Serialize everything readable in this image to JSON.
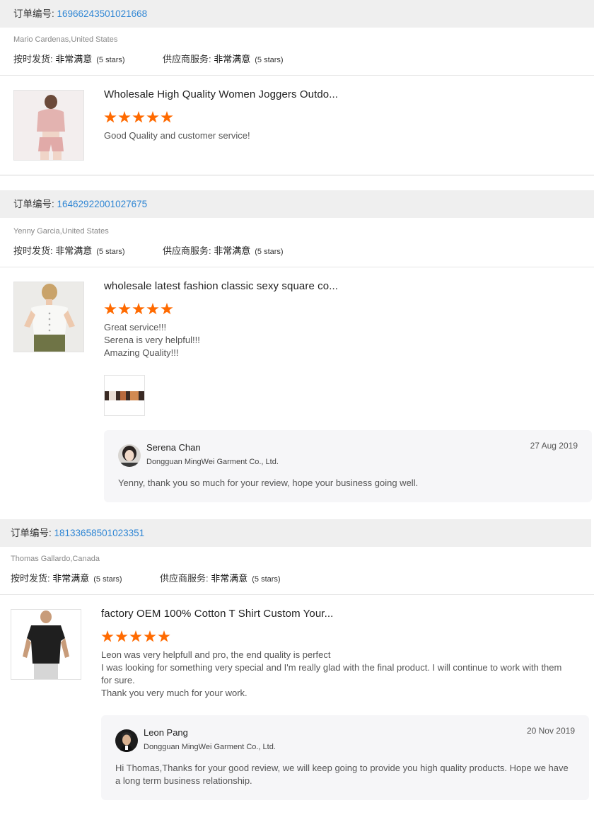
{
  "labels": {
    "order_prefix": "订单编号: ",
    "ontime_delivery": "按时发货: ",
    "supplier_service": "供应商服务: "
  },
  "reviews": [
    {
      "order_no": "16966243501021668",
      "buyer": "Mario Cardenas,United States",
      "ontime_value": "非常满意",
      "ontime_stars": "(5 stars)",
      "service_value": "非常满意",
      "service_stars": "(5 stars)",
      "product_title": "Wholesale High Quality Women Joggers Outdo...",
      "rating": 5,
      "comment": "Good Quality and customer service!"
    },
    {
      "order_no": "16462922001027675",
      "buyer": "Yenny Garcia,United States",
      "ontime_value": "非常满意",
      "ontime_stars": "(5 stars)",
      "service_value": "非常满意",
      "service_stars": "(5 stars)",
      "product_title": "wholesale latest fashion classic sexy square co...",
      "rating": 5,
      "comment": [
        "Great service!!!",
        "Serena is very helpful!!!",
        "Amazing Quality!!!"
      ],
      "reply": {
        "name": "Serena Chan",
        "company": "Dongguan MingWei Garment Co., Ltd.",
        "date": "27 Aug 2019",
        "text": "Yenny, thank you so much for your review, hope your business going well."
      }
    },
    {
      "order_no": "18133658501023351",
      "buyer": "Thomas Gallardo,Canada",
      "ontime_value": "非常满意",
      "ontime_stars": "(5 stars)",
      "service_value": "非常满意",
      "service_stars": "(5 stars)",
      "product_title": "factory OEM 100% Cotton T Shirt Custom Your...",
      "rating": 5,
      "comment": [
        "Leon was very helpfull and pro, the end quality is perfect",
        "I was looking for something very special and I'm really glad with the final product. I will continue to work with them for sure.",
        "Thank you very much for your work."
      ],
      "reply": {
        "name": "Leon Pang",
        "company": "Dongguan MingWei Garment Co., Ltd.",
        "date": "20 Nov 2019",
        "text": "Hi Thomas,Thanks for your good review,  we will keep going to provide you high quality products. Hope we have a long term business relationship."
      }
    }
  ],
  "colors": {
    "star": "#ff6a00",
    "order_number": "#2f86d4",
    "order_bar_bg": "#efefef",
    "reply_bg": "#f6f6f8"
  }
}
